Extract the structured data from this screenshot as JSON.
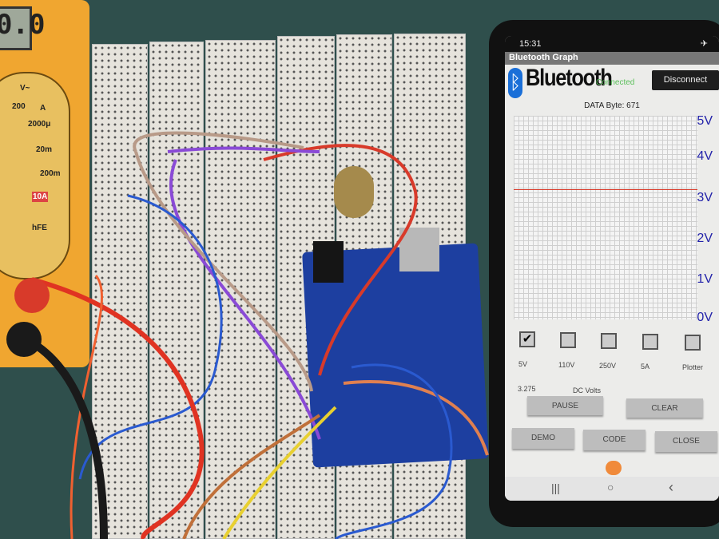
{
  "multimeter": {
    "display": "0.0",
    "labels": [
      "V~",
      "200",
      "A",
      "2000μ",
      "20m",
      "200m",
      "10A",
      "hFE"
    ]
  },
  "phone": {
    "status_time": "15:31",
    "app_title": "Bluetooth Graph",
    "logo_text": "Bluetooth",
    "connection_status": "Connected",
    "disconnect_label": "Disconnect",
    "data_byte": "DATA Byte: 671",
    "graph": {
      "y_labels": [
        "5V",
        "4V",
        "3V",
        "2V",
        "1V",
        "0V"
      ],
      "ylim": [
        0,
        5
      ],
      "line_value": 3.275,
      "line_color": "#d83a2a"
    },
    "checkboxes": [
      {
        "label": "5V",
        "checked": true
      },
      {
        "label": "110V",
        "checked": false
      },
      {
        "label": "250V",
        "checked": false
      },
      {
        "label": "5A",
        "checked": false
      },
      {
        "label": "Plotter",
        "checked": false
      }
    ],
    "reading_value": "3.275",
    "reading_unit": "DC Volts",
    "buttons": {
      "pause": "PAUSE",
      "clear": "CLEAR",
      "demo": "DEMO",
      "code": "CODE",
      "close": "CLOSE"
    },
    "nav": {
      "recents": "|||",
      "home": "○",
      "back": "‹"
    }
  }
}
